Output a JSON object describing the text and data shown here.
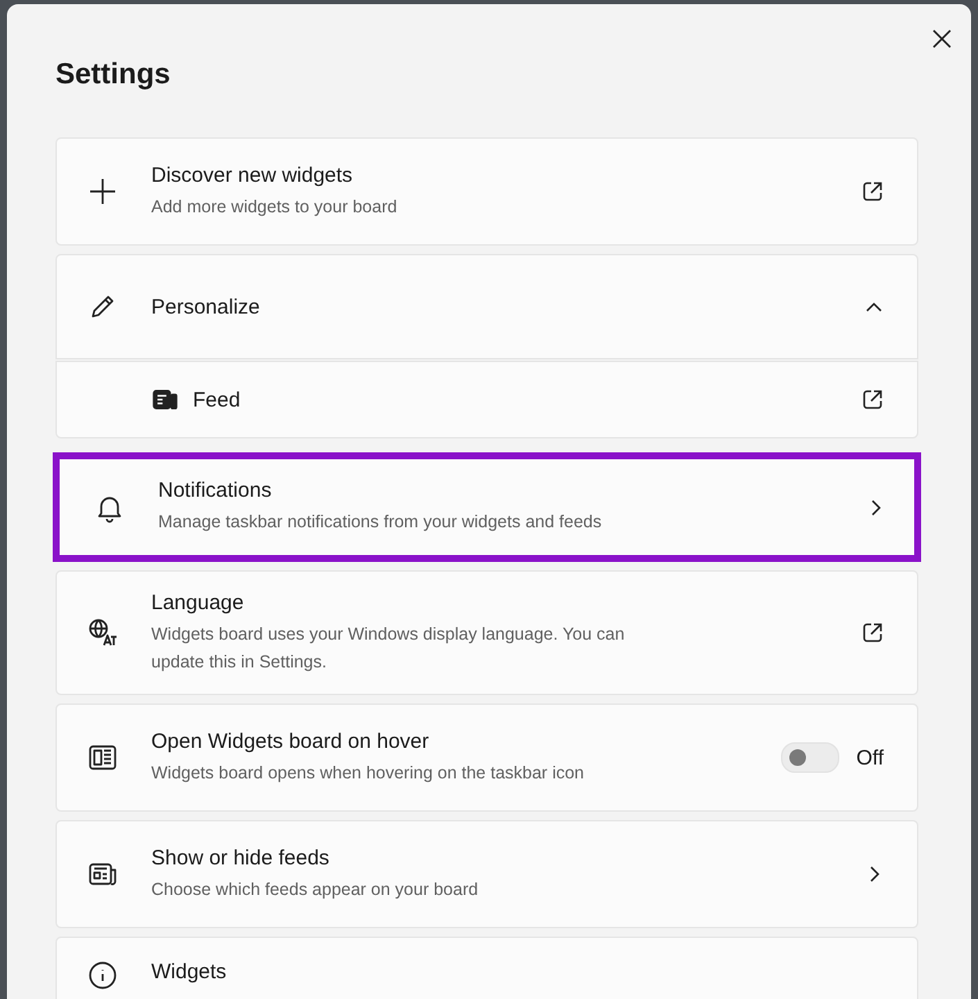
{
  "window": {
    "title": "Settings"
  },
  "items": [
    {
      "kind": "link",
      "title": "Discover new widgets",
      "subtitle": "Add more widgets to your board",
      "highlighted": false
    },
    {
      "kind": "expand",
      "title": "Personalize",
      "expanded": true,
      "highlighted": false
    },
    {
      "kind": "sub",
      "title": "Feed",
      "highlighted": false
    },
    {
      "kind": "nav",
      "title": "Notifications",
      "subtitle": "Manage taskbar notifications from your widgets and feeds",
      "highlighted": true
    },
    {
      "kind": "link",
      "title": "Language",
      "subtitle": "Widgets board uses your Windows display language. You can update this in Settings.",
      "highlighted": false
    },
    {
      "kind": "toggle",
      "title": "Open Widgets board on hover",
      "subtitle": "Widgets board opens when hovering on the taskbar icon",
      "on": false,
      "state_label": "Off",
      "highlighted": false
    },
    {
      "kind": "nav",
      "title": "Show or hide feeds",
      "subtitle": "Choose which feeds appear on your board",
      "highlighted": false
    },
    {
      "kind": "plain",
      "title": "Widgets",
      "highlighted": false
    }
  ]
}
